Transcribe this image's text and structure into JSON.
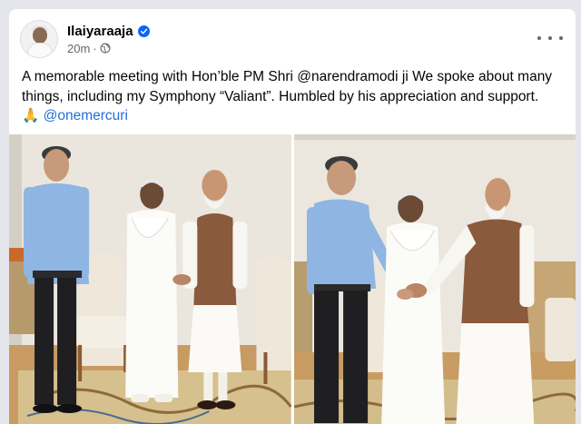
{
  "post": {
    "author": "Ilaiyaraaja",
    "time": "20m",
    "separator": "·",
    "text_before": "A memorable meeting with Hon’ble PM Shri @narendramodi ji We spoke about many things, including my Symphony “Valiant”. Humbled by his appreciation and support. ",
    "emoji": "🙏",
    "mention": "@onemercuri"
  },
  "icons": {
    "verified": "verified-badge-icon",
    "privacy": "globe-icon",
    "menu": "more-options-icon"
  },
  "colors": {
    "verified": "#0866ff",
    "link": "#216fdb",
    "secondary_text": "#65676b"
  }
}
